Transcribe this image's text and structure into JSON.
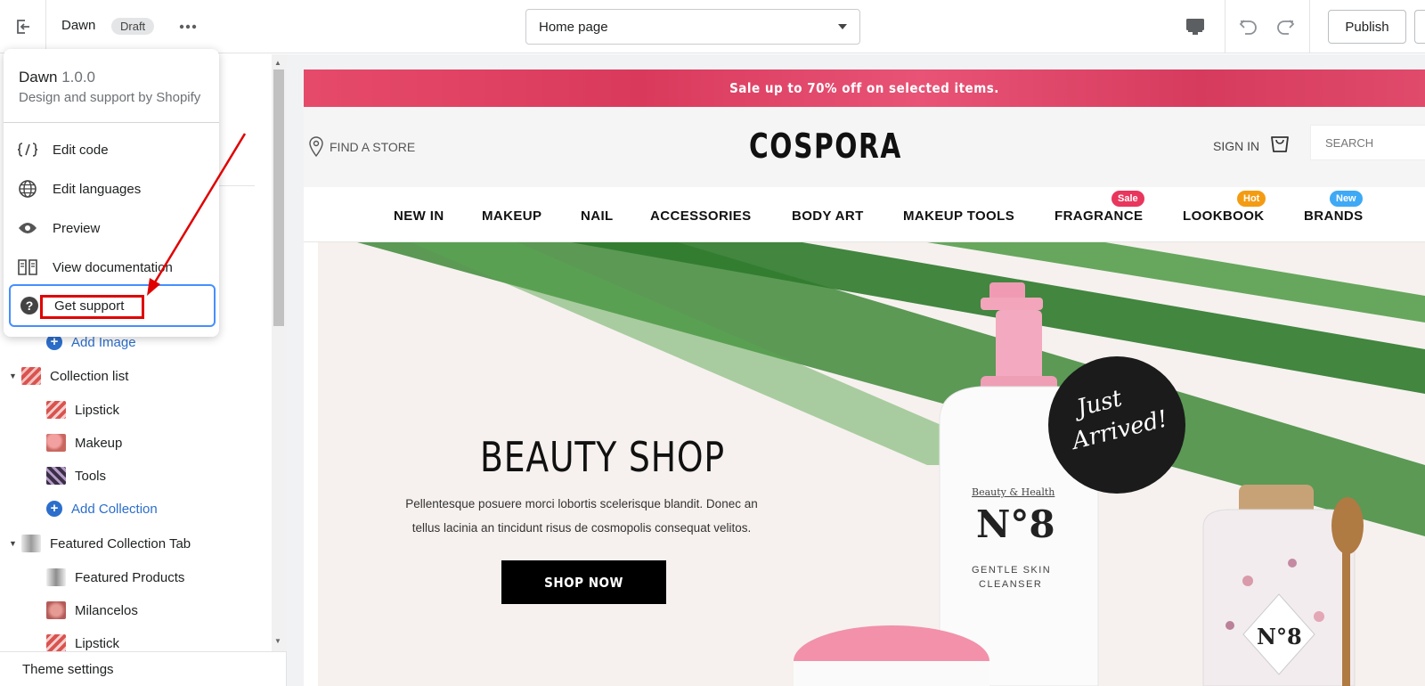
{
  "topbar": {
    "theme_name": "Dawn",
    "status_badge": "Draft",
    "page_selector": "Home page",
    "publish_label": "Publish"
  },
  "popover": {
    "theme_name": "Dawn",
    "theme_version": "1.0.0",
    "subtitle": "Design and support by Shopify",
    "items": [
      {
        "label": "Edit code",
        "icon": "code-icon"
      },
      {
        "label": "Edit languages",
        "icon": "globe-icon"
      },
      {
        "label": "Preview",
        "icon": "eye-icon"
      },
      {
        "label": "View documentation",
        "icon": "book-icon"
      },
      {
        "label": "Get support",
        "icon": "question-icon"
      }
    ]
  },
  "sidebar": {
    "add_image": "Add Image",
    "collection_list": {
      "label": "Collection list",
      "items": [
        "Lipstick",
        "Makeup",
        "Tools"
      ],
      "add_label": "Add Collection"
    },
    "featured_tab": {
      "label": "Featured Collection Tab",
      "items": [
        "Featured Products",
        "Milancelos",
        "Lipstick"
      ]
    },
    "theme_settings": "Theme settings"
  },
  "store": {
    "announcement": "Sale up to 70% off on selected items.",
    "find_store": "FIND A STORE",
    "logo": "COSPORA",
    "sign_in": "SIGN IN",
    "search_placeholder": "SEARCH",
    "nav": [
      {
        "label": "NEW IN"
      },
      {
        "label": "MAKEUP"
      },
      {
        "label": "NAIL"
      },
      {
        "label": "ACCESSORIES"
      },
      {
        "label": "BODY ART"
      },
      {
        "label": "MAKEUP TOOLS"
      },
      {
        "label": "FRAGRANCE",
        "badge": "Sale",
        "badge_color": "#e8365d"
      },
      {
        "label": "LOOKBOOK",
        "badge": "Hot",
        "badge_color": "#f39c12"
      },
      {
        "label": "BRANDS",
        "badge": "New",
        "badge_color": "#3ea9f5"
      }
    ],
    "hero": {
      "title": "BEAUTY SHOP",
      "text_line1": "Pellentesque posuere morci lobortis scelerisque blandit. Donec an",
      "text_line2": "tellus lacinia an tincidunt risus de cosmopolis consequat velitos.",
      "button": "SHOP NOW",
      "sticker_line1": "Just",
      "sticker_line2": "Arrived!",
      "bottle_brand": "Beauty & Health",
      "bottle_number": "N°8",
      "bottle_line1": "GENTLE SKIN",
      "bottle_line2": "CLEANSER",
      "jar_number": "N°8"
    }
  },
  "colors": {
    "accent_blue": "#2c6ecb",
    "focus_blue": "#458fff",
    "annotation_red": "#e00000",
    "announcement_pink": "#e04a6b"
  }
}
